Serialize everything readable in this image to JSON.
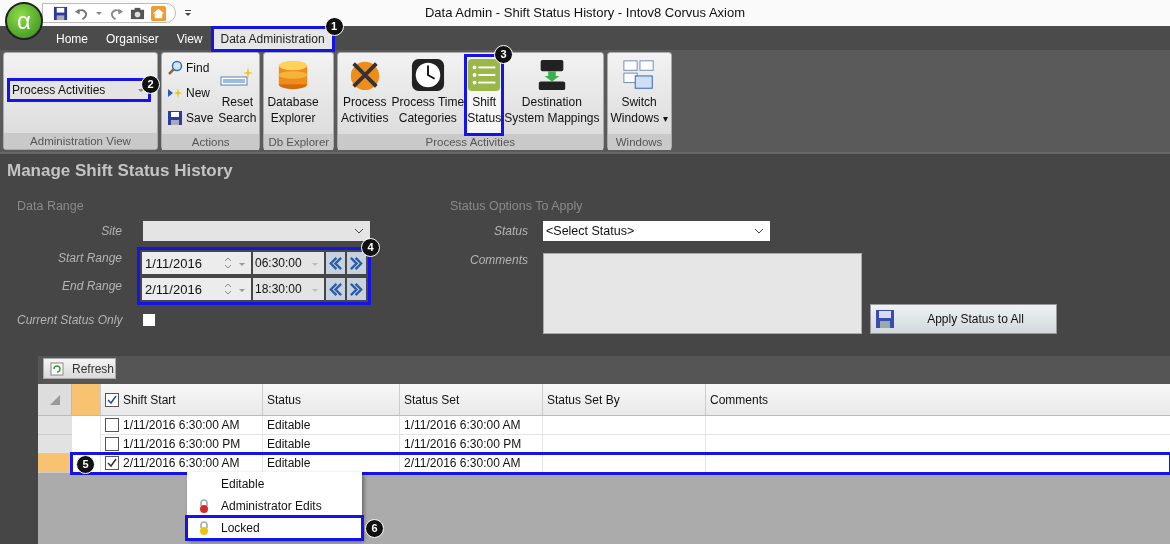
{
  "window": {
    "logo": "α",
    "title": "Data Admin - Shift Status History - Intov8 Corvus Axiom"
  },
  "tabs": [
    {
      "label": "Home",
      "selected": false
    },
    {
      "label": "Organiser",
      "selected": false
    },
    {
      "label": "View",
      "selected": false
    },
    {
      "label": "Data Administration",
      "selected": true,
      "callout": "1"
    }
  ],
  "ribbon": {
    "admin_view": {
      "label": "Administration View",
      "value": "Process Activities",
      "callout": "2"
    },
    "actions": {
      "label": "Actions",
      "small": [
        "Find",
        "New",
        "Save"
      ],
      "reset": "Reset\nSearch"
    },
    "db_explorer": {
      "label": "Db Explorer",
      "button": "Database\nExplorer"
    },
    "process": {
      "label": "Process Activities",
      "buttons": [
        {
          "label": "Process\nActivities",
          "selected": false
        },
        {
          "label": "Process Time\nCategories",
          "selected": false
        },
        {
          "label": "Shift\nStatus",
          "selected": true,
          "callout": "3"
        },
        {
          "label": "Destination\nSystem Mappings",
          "selected": false
        }
      ]
    },
    "windows": {
      "label": "Windows",
      "button": "Switch\nWindows",
      "caret": "▾"
    }
  },
  "form": {
    "title": "Manage Shift Status History",
    "data_range": {
      "label": "Data Range",
      "site_label": "Site",
      "callout": "4",
      "ranges": [
        {
          "label": "Start Range",
          "date": "1/11/2016",
          "time": "06:30:00"
        },
        {
          "label": "End Range",
          "date": "2/11/2016",
          "time": "18:30:00"
        }
      ],
      "current_only": {
        "label": "Current Status Only",
        "checked": false
      }
    },
    "status_options": {
      "label": "Status Options To Apply",
      "status_label": "Status",
      "status_value": "<Select Status>",
      "comments_label": "Comments",
      "apply": "Apply Status to All"
    }
  },
  "grid": {
    "refresh": "Refresh",
    "select_all": true,
    "columns": [
      "Shift Start",
      "Status",
      "Status Set",
      "Status Set By",
      "Comments"
    ],
    "rows": [
      {
        "shift_start": "1/11/2016 6:30:00 AM",
        "status": "Editable",
        "status_set": "1/11/2016 6:30:00 AM",
        "checked": false,
        "selected": false
      },
      {
        "shift_start": "1/11/2016 6:30:00 PM",
        "status": "Editable",
        "status_set": "1/11/2016 6:30:00 PM",
        "checked": false,
        "selected": false
      },
      {
        "shift_start": "2/11/2016 6:30:00 AM",
        "status": "Editable",
        "status_set": "2/11/2016 6:30:00 AM",
        "checked": true,
        "selected": true,
        "callout": "5"
      }
    ]
  },
  "context_menu": [
    {
      "label": "Editable",
      "kind": "plain"
    },
    {
      "label": "Administrator Edits",
      "kind": "lock",
      "color": "#d42a2a"
    },
    {
      "label": "Locked",
      "kind": "lock",
      "color": "#e8c41a",
      "callout": "6"
    }
  ]
}
